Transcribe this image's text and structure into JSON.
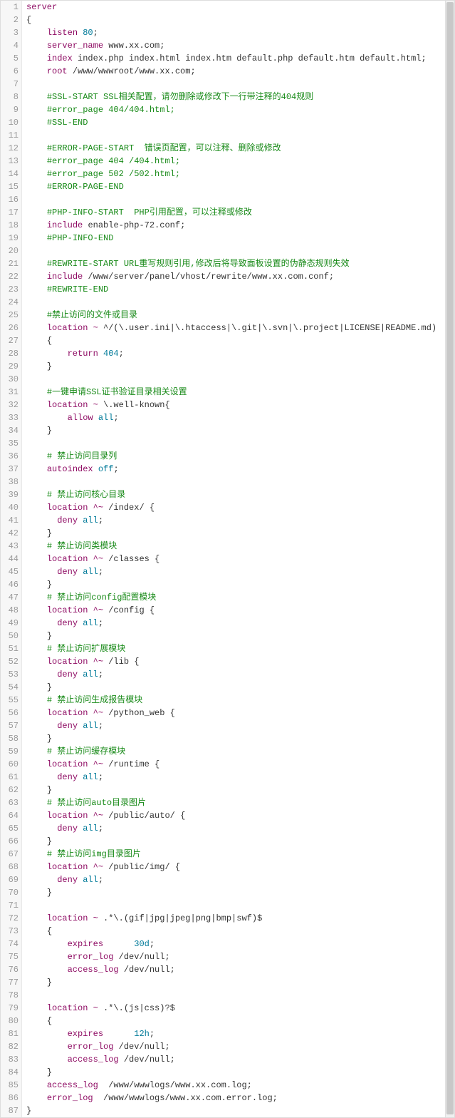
{
  "lines": [
    {
      "n": 1,
      "indent": 0,
      "tokens": [
        [
          "dir",
          "server"
        ]
      ]
    },
    {
      "n": 2,
      "indent": 0,
      "tokens": [
        [
          "pun",
          "{"
        ]
      ]
    },
    {
      "n": 3,
      "indent": 1,
      "tokens": [
        [
          "dir",
          "listen"
        ],
        [
          "sp",
          " "
        ],
        [
          "num",
          "80"
        ],
        [
          "pun",
          ";"
        ]
      ]
    },
    {
      "n": 4,
      "indent": 1,
      "tokens": [
        [
          "dir",
          "server_name"
        ],
        [
          "sp",
          " "
        ],
        [
          "str",
          "www.xx.com"
        ],
        [
          "pun",
          ";"
        ]
      ]
    },
    {
      "n": 5,
      "indent": 1,
      "tokens": [
        [
          "dir",
          "index"
        ],
        [
          "sp",
          " "
        ],
        [
          "str",
          "index.php index.html index.htm default.php default.htm default.html"
        ],
        [
          "pun",
          ";"
        ]
      ]
    },
    {
      "n": 6,
      "indent": 1,
      "tokens": [
        [
          "dir",
          "root"
        ],
        [
          "sp",
          " "
        ],
        [
          "str",
          "/www/wwwroot/www.xx.com"
        ],
        [
          "pun",
          ";"
        ]
      ]
    },
    {
      "n": 7,
      "indent": 1,
      "tokens": []
    },
    {
      "n": 8,
      "indent": 1,
      "tokens": [
        [
          "cmt",
          "#SSL-START SSL相关配置，请勿删除或修改下一行带注释的404规则"
        ]
      ]
    },
    {
      "n": 9,
      "indent": 1,
      "tokens": [
        [
          "cmt",
          "#error_page 404/404.html;"
        ]
      ]
    },
    {
      "n": 10,
      "indent": 1,
      "tokens": [
        [
          "cmt",
          "#SSL-END"
        ]
      ]
    },
    {
      "n": 11,
      "indent": 1,
      "tokens": []
    },
    {
      "n": 12,
      "indent": 1,
      "tokens": [
        [
          "cmt",
          "#ERROR-PAGE-START  错误页配置，可以注释、删除或修改"
        ]
      ]
    },
    {
      "n": 13,
      "indent": 1,
      "tokens": [
        [
          "cmt",
          "#error_page 404 /404.html;"
        ]
      ]
    },
    {
      "n": 14,
      "indent": 1,
      "tokens": [
        [
          "cmt",
          "#error_page 502 /502.html;"
        ]
      ]
    },
    {
      "n": 15,
      "indent": 1,
      "tokens": [
        [
          "cmt",
          "#ERROR-PAGE-END"
        ]
      ]
    },
    {
      "n": 16,
      "indent": 1,
      "tokens": []
    },
    {
      "n": 17,
      "indent": 1,
      "tokens": [
        [
          "cmt",
          "#PHP-INFO-START  PHP引用配置，可以注释或修改"
        ]
      ]
    },
    {
      "n": 18,
      "indent": 1,
      "tokens": [
        [
          "dir",
          "include"
        ],
        [
          "sp",
          " "
        ],
        [
          "str",
          "enable-php-72.conf"
        ],
        [
          "pun",
          ";"
        ]
      ]
    },
    {
      "n": 19,
      "indent": 1,
      "tokens": [
        [
          "cmt",
          "#PHP-INFO-END"
        ]
      ]
    },
    {
      "n": 20,
      "indent": 1,
      "tokens": []
    },
    {
      "n": 21,
      "indent": 1,
      "tokens": [
        [
          "cmt",
          "#REWRITE-START URL重写规则引用,修改后将导致面板设置的伪静态规则失效"
        ]
      ]
    },
    {
      "n": 22,
      "indent": 1,
      "tokens": [
        [
          "dir",
          "include"
        ],
        [
          "sp",
          " "
        ],
        [
          "str",
          "/www/server/panel/vhost/rewrite/www.xx.com.conf"
        ],
        [
          "pun",
          ";"
        ]
      ]
    },
    {
      "n": 23,
      "indent": 1,
      "tokens": [
        [
          "cmt",
          "#REWRITE-END"
        ]
      ]
    },
    {
      "n": 24,
      "indent": 1,
      "tokens": []
    },
    {
      "n": 25,
      "indent": 1,
      "tokens": [
        [
          "cmt",
          "#禁止访问的文件或目录"
        ]
      ]
    },
    {
      "n": 26,
      "indent": 1,
      "tokens": [
        [
          "dir",
          "location"
        ],
        [
          "sp",
          " "
        ],
        [
          "reg",
          "~"
        ],
        [
          "sp",
          " "
        ],
        [
          "str",
          "^/(\\.user.ini|\\.htaccess|\\.git|\\.svn|\\.project|LICENSE|README.md)"
        ]
      ]
    },
    {
      "n": 27,
      "indent": 1,
      "tokens": [
        [
          "pun",
          "{"
        ]
      ]
    },
    {
      "n": 28,
      "indent": 2,
      "tokens": [
        [
          "dir",
          "return"
        ],
        [
          "sp",
          " "
        ],
        [
          "num",
          "404"
        ],
        [
          "pun",
          ";"
        ]
      ]
    },
    {
      "n": 29,
      "indent": 1,
      "tokens": [
        [
          "pun",
          "}"
        ]
      ]
    },
    {
      "n": 30,
      "indent": 1,
      "tokens": []
    },
    {
      "n": 31,
      "indent": 1,
      "tokens": [
        [
          "cmt",
          "#一键申请SSL证书验证目录相关设置"
        ]
      ]
    },
    {
      "n": 32,
      "indent": 1,
      "tokens": [
        [
          "dir",
          "location"
        ],
        [
          "sp",
          " "
        ],
        [
          "reg",
          "~"
        ],
        [
          "sp",
          " "
        ],
        [
          "str",
          "\\.well-known"
        ],
        [
          "pun",
          "{"
        ]
      ]
    },
    {
      "n": 33,
      "indent": 2,
      "tokens": [
        [
          "dir",
          "allow"
        ],
        [
          "sp",
          " "
        ],
        [
          "val",
          "all"
        ],
        [
          "pun",
          ";"
        ]
      ]
    },
    {
      "n": 34,
      "indent": 1,
      "tokens": [
        [
          "pun",
          "}"
        ]
      ]
    },
    {
      "n": 35,
      "indent": 1,
      "tokens": []
    },
    {
      "n": 36,
      "indent": 1,
      "tokens": [
        [
          "cmt",
          "# 禁止访问目录列"
        ]
      ]
    },
    {
      "n": 37,
      "indent": 1,
      "tokens": [
        [
          "dir",
          "autoindex"
        ],
        [
          "sp",
          " "
        ],
        [
          "val",
          "off"
        ],
        [
          "pun",
          ";"
        ]
      ]
    },
    {
      "n": 38,
      "indent": 1,
      "tokens": []
    },
    {
      "n": 39,
      "indent": 1,
      "tokens": [
        [
          "cmt",
          "# 禁止访问核心目录"
        ]
      ]
    },
    {
      "n": 40,
      "indent": 1,
      "tokens": [
        [
          "dir",
          "location"
        ],
        [
          "sp",
          " "
        ],
        [
          "reg",
          "^~"
        ],
        [
          "sp",
          " "
        ],
        [
          "str",
          "/index/"
        ],
        [
          "sp",
          " "
        ],
        [
          "pun",
          "{"
        ]
      ]
    },
    {
      "n": 41,
      "indent": 1,
      "tokens": [
        [
          "sp",
          "  "
        ],
        [
          "dir",
          "deny"
        ],
        [
          "sp",
          " "
        ],
        [
          "val",
          "all"
        ],
        [
          "pun",
          ";"
        ]
      ]
    },
    {
      "n": 42,
      "indent": 1,
      "tokens": [
        [
          "pun",
          "}"
        ]
      ]
    },
    {
      "n": 43,
      "indent": 1,
      "tokens": [
        [
          "cmt",
          "# 禁止访问类模块"
        ]
      ]
    },
    {
      "n": 44,
      "indent": 1,
      "tokens": [
        [
          "dir",
          "location"
        ],
        [
          "sp",
          " "
        ],
        [
          "reg",
          "^~"
        ],
        [
          "sp",
          " "
        ],
        [
          "str",
          "/classes"
        ],
        [
          "sp",
          " "
        ],
        [
          "pun",
          "{"
        ]
      ]
    },
    {
      "n": 45,
      "indent": 1,
      "tokens": [
        [
          "sp",
          "  "
        ],
        [
          "dir",
          "deny"
        ],
        [
          "sp",
          " "
        ],
        [
          "val",
          "all"
        ],
        [
          "pun",
          ";"
        ]
      ]
    },
    {
      "n": 46,
      "indent": 1,
      "tokens": [
        [
          "pun",
          "}"
        ]
      ]
    },
    {
      "n": 47,
      "indent": 1,
      "tokens": [
        [
          "cmt",
          "# 禁止访问config配置模块"
        ]
      ]
    },
    {
      "n": 48,
      "indent": 1,
      "tokens": [
        [
          "dir",
          "location"
        ],
        [
          "sp",
          " "
        ],
        [
          "reg",
          "^~"
        ],
        [
          "sp",
          " "
        ],
        [
          "str",
          "/config"
        ],
        [
          "sp",
          " "
        ],
        [
          "pun",
          "{"
        ]
      ]
    },
    {
      "n": 49,
      "indent": 1,
      "tokens": [
        [
          "sp",
          "  "
        ],
        [
          "dir",
          "deny"
        ],
        [
          "sp",
          " "
        ],
        [
          "val",
          "all"
        ],
        [
          "pun",
          ";"
        ]
      ]
    },
    {
      "n": 50,
      "indent": 1,
      "tokens": [
        [
          "pun",
          "}"
        ]
      ]
    },
    {
      "n": 51,
      "indent": 1,
      "tokens": [
        [
          "cmt",
          "# 禁止访问扩展模块"
        ]
      ]
    },
    {
      "n": 52,
      "indent": 1,
      "tokens": [
        [
          "dir",
          "location"
        ],
        [
          "sp",
          " "
        ],
        [
          "reg",
          "^~"
        ],
        [
          "sp",
          " "
        ],
        [
          "str",
          "/lib"
        ],
        [
          "sp",
          " "
        ],
        [
          "pun",
          "{"
        ]
      ]
    },
    {
      "n": 53,
      "indent": 1,
      "tokens": [
        [
          "sp",
          "  "
        ],
        [
          "dir",
          "deny"
        ],
        [
          "sp",
          " "
        ],
        [
          "val",
          "all"
        ],
        [
          "pun",
          ";"
        ]
      ]
    },
    {
      "n": 54,
      "indent": 1,
      "tokens": [
        [
          "pun",
          "}"
        ]
      ]
    },
    {
      "n": 55,
      "indent": 1,
      "tokens": [
        [
          "cmt",
          "# 禁止访问生成报告模块"
        ]
      ]
    },
    {
      "n": 56,
      "indent": 1,
      "tokens": [
        [
          "dir",
          "location"
        ],
        [
          "sp",
          " "
        ],
        [
          "reg",
          "^~"
        ],
        [
          "sp",
          " "
        ],
        [
          "str",
          "/python_web"
        ],
        [
          "sp",
          " "
        ],
        [
          "pun",
          "{"
        ]
      ]
    },
    {
      "n": 57,
      "indent": 1,
      "tokens": [
        [
          "sp",
          "  "
        ],
        [
          "dir",
          "deny"
        ],
        [
          "sp",
          " "
        ],
        [
          "val",
          "all"
        ],
        [
          "pun",
          ";"
        ]
      ]
    },
    {
      "n": 58,
      "indent": 1,
      "tokens": [
        [
          "pun",
          "}"
        ]
      ]
    },
    {
      "n": 59,
      "indent": 1,
      "tokens": [
        [
          "cmt",
          "# 禁止访问缓存模块"
        ]
      ]
    },
    {
      "n": 60,
      "indent": 1,
      "tokens": [
        [
          "dir",
          "location"
        ],
        [
          "sp",
          " "
        ],
        [
          "reg",
          "^~"
        ],
        [
          "sp",
          " "
        ],
        [
          "str",
          "/runtime"
        ],
        [
          "sp",
          " "
        ],
        [
          "pun",
          "{"
        ]
      ]
    },
    {
      "n": 61,
      "indent": 1,
      "tokens": [
        [
          "sp",
          "  "
        ],
        [
          "dir",
          "deny"
        ],
        [
          "sp",
          " "
        ],
        [
          "val",
          "all"
        ],
        [
          "pun",
          ";"
        ]
      ]
    },
    {
      "n": 62,
      "indent": 1,
      "tokens": [
        [
          "pun",
          "}"
        ]
      ]
    },
    {
      "n": 63,
      "indent": 1,
      "tokens": [
        [
          "cmt",
          "# 禁止访问auto目录图片"
        ]
      ]
    },
    {
      "n": 64,
      "indent": 1,
      "tokens": [
        [
          "dir",
          "location"
        ],
        [
          "sp",
          " "
        ],
        [
          "reg",
          "^~"
        ],
        [
          "sp",
          " "
        ],
        [
          "str",
          "/public/auto/"
        ],
        [
          "sp",
          " "
        ],
        [
          "pun",
          "{"
        ]
      ]
    },
    {
      "n": 65,
      "indent": 1,
      "tokens": [
        [
          "sp",
          "  "
        ],
        [
          "dir",
          "deny"
        ],
        [
          "sp",
          " "
        ],
        [
          "val",
          "all"
        ],
        [
          "pun",
          ";"
        ]
      ]
    },
    {
      "n": 66,
      "indent": 1,
      "tokens": [
        [
          "pun",
          "}"
        ]
      ]
    },
    {
      "n": 67,
      "indent": 1,
      "tokens": [
        [
          "cmt",
          "# 禁止访问img目录图片"
        ]
      ]
    },
    {
      "n": 68,
      "indent": 1,
      "tokens": [
        [
          "dir",
          "location"
        ],
        [
          "sp",
          " "
        ],
        [
          "reg",
          "^~"
        ],
        [
          "sp",
          " "
        ],
        [
          "str",
          "/public/img/"
        ],
        [
          "sp",
          " "
        ],
        [
          "pun",
          "{"
        ]
      ]
    },
    {
      "n": 69,
      "indent": 1,
      "tokens": [
        [
          "sp",
          "  "
        ],
        [
          "dir",
          "deny"
        ],
        [
          "sp",
          " "
        ],
        [
          "val",
          "all"
        ],
        [
          "pun",
          ";"
        ]
      ]
    },
    {
      "n": 70,
      "indent": 1,
      "tokens": [
        [
          "pun",
          "}"
        ]
      ]
    },
    {
      "n": 71,
      "indent": 1,
      "tokens": []
    },
    {
      "n": 72,
      "indent": 1,
      "tokens": [
        [
          "dir",
          "location"
        ],
        [
          "sp",
          " "
        ],
        [
          "reg",
          "~"
        ],
        [
          "sp",
          " "
        ],
        [
          "str",
          ".*\\.(gif|jpg|jpeg|png|bmp|swf)$"
        ]
      ]
    },
    {
      "n": 73,
      "indent": 1,
      "tokens": [
        [
          "pun",
          "{"
        ]
      ]
    },
    {
      "n": 74,
      "indent": 2,
      "tokens": [
        [
          "dir",
          "expires"
        ],
        [
          "sp",
          "      "
        ],
        [
          "num",
          "30d"
        ],
        [
          "pun",
          ";"
        ]
      ]
    },
    {
      "n": 75,
      "indent": 2,
      "tokens": [
        [
          "dir",
          "error_log"
        ],
        [
          "sp",
          " "
        ],
        [
          "str",
          "/dev/null"
        ],
        [
          "pun",
          ";"
        ]
      ]
    },
    {
      "n": 76,
      "indent": 2,
      "tokens": [
        [
          "dir",
          "access_log"
        ],
        [
          "sp",
          " "
        ],
        [
          "str",
          "/dev/null"
        ],
        [
          "pun",
          ";"
        ]
      ]
    },
    {
      "n": 77,
      "indent": 1,
      "tokens": [
        [
          "pun",
          "}"
        ]
      ]
    },
    {
      "n": 78,
      "indent": 1,
      "tokens": []
    },
    {
      "n": 79,
      "indent": 1,
      "tokens": [
        [
          "dir",
          "location"
        ],
        [
          "sp",
          " "
        ],
        [
          "reg",
          "~"
        ],
        [
          "sp",
          " "
        ],
        [
          "str",
          ".*\\.(js|css)?$"
        ]
      ]
    },
    {
      "n": 80,
      "indent": 1,
      "tokens": [
        [
          "pun",
          "{"
        ]
      ]
    },
    {
      "n": 81,
      "indent": 2,
      "tokens": [
        [
          "dir",
          "expires"
        ],
        [
          "sp",
          "      "
        ],
        [
          "num",
          "12h"
        ],
        [
          "pun",
          ";"
        ]
      ]
    },
    {
      "n": 82,
      "indent": 2,
      "tokens": [
        [
          "dir",
          "error_log"
        ],
        [
          "sp",
          " "
        ],
        [
          "str",
          "/dev/null"
        ],
        [
          "pun",
          ";"
        ]
      ]
    },
    {
      "n": 83,
      "indent": 2,
      "tokens": [
        [
          "dir",
          "access_log"
        ],
        [
          "sp",
          " "
        ],
        [
          "str",
          "/dev/null"
        ],
        [
          "pun",
          ";"
        ]
      ]
    },
    {
      "n": 84,
      "indent": 1,
      "tokens": [
        [
          "pun",
          "}"
        ]
      ]
    },
    {
      "n": 85,
      "indent": 1,
      "tokens": [
        [
          "dir",
          "access_log"
        ],
        [
          "sp",
          "  "
        ],
        [
          "str",
          "/www/wwwlogs/www.xx.com.log"
        ],
        [
          "pun",
          ";"
        ]
      ]
    },
    {
      "n": 86,
      "indent": 1,
      "tokens": [
        [
          "dir",
          "error_log"
        ],
        [
          "sp",
          "  "
        ],
        [
          "str",
          "/www/wwwlogs/www.xx.com.error.log"
        ],
        [
          "pun",
          ";"
        ]
      ]
    },
    {
      "n": 87,
      "indent": 0,
      "tokens": [
        [
          "pun",
          "}"
        ]
      ]
    }
  ],
  "scrollbar": {
    "thumbTop": 2,
    "thumbHeight": 1560
  }
}
